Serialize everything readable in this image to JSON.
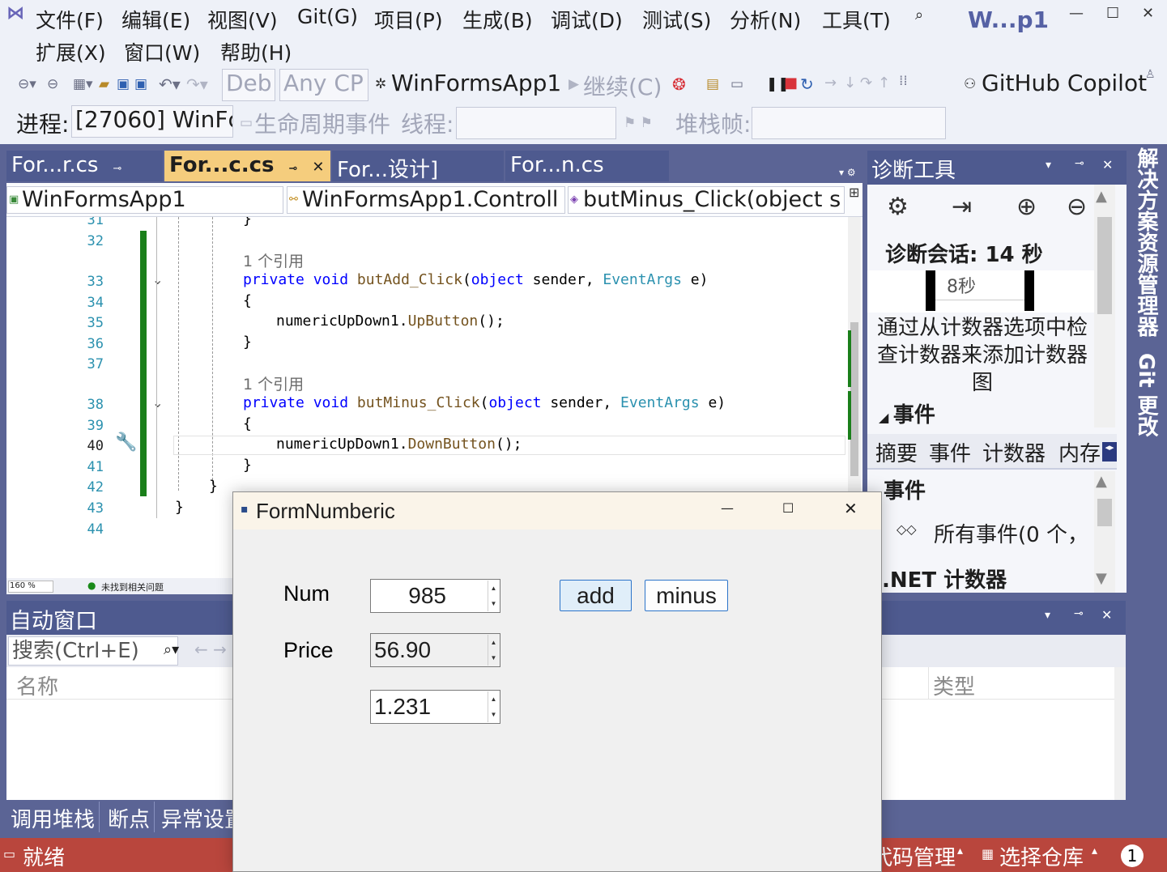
{
  "menu": [
    "文件(F)",
    "编辑(E)",
    "视图(V)",
    "Git(G)",
    "项目(P)",
    "生成(B)",
    "调试(D)",
    "测试(S)",
    "分析(N)",
    "工具(T)",
    "扩展(X)",
    "窗口(W)",
    "帮助(H)"
  ],
  "window": {
    "title": "W...p1",
    "search_icon": "⌕"
  },
  "toolbar": {
    "config": "Deb",
    "platform": "Any CP",
    "startup_project": "WinFormsApp1",
    "continue": "继续(C)",
    "copilot": "GitHub Copilot"
  },
  "debug_location": {
    "process_label": "进程:",
    "process_value": "[27060] WinFc",
    "lifecycle": "生命周期事件",
    "thread_label": "线程:",
    "stack_label": "堆栈帧:"
  },
  "tabs": [
    "For...r.cs",
    "For...c.cs",
    "For...设计]",
    "For...n.cs"
  ],
  "nav": {
    "project": "WinFormsApp1",
    "class": "WinFormsApp1.Controll",
    "member": "butMinus_Click(object s"
  },
  "code": {
    "line_numbers": [
      "31",
      "32",
      "33",
      "34",
      "35",
      "36",
      "37",
      "38",
      "39",
      "40",
      "41",
      "42",
      "43",
      "44"
    ],
    "refs1": "1 个引用",
    "refs2": "1 个引用",
    "add_sig": {
      "mod": "private",
      "ret": "void",
      "name": "butAdd_Click",
      "p1t": "object",
      "p1": "sender,",
      "p2t": "EventArgs",
      "p2": "e)"
    },
    "add_body": {
      "obj": "numericUpDown1.",
      "call": "UpButton",
      "tail": "();"
    },
    "minus_sig": {
      "mod": "private",
      "ret": "void",
      "name": "butMinus_Click",
      "p1t": "object",
      "p1": "sender,",
      "p2t": "EventArgs",
      "p2": "e)"
    },
    "minus_body": {
      "obj": "numericUpDown1.",
      "call": "DownButton",
      "tail": "();"
    }
  },
  "editor_status": {
    "zoom": "160 %",
    "issues": "未找到相关问题"
  },
  "diagnostics": {
    "title": "诊断工具",
    "session": "诊断会话: 14 秒",
    "timeline_tick": "8秒",
    "hint": "通过从计数器选项中检查计数器来添加计数器图",
    "events_header": "事件",
    "subtabs": [
      "摘要",
      "事件",
      "计数器",
      "内存"
    ],
    "events_section": "事件",
    "all_events": "所有事件(0 个，",
    "net_counters": ".NET 计数器"
  },
  "side_tabs": [
    "解决方案资源管理器",
    "Git 更改"
  ],
  "auto_window": {
    "title": "自动窗口",
    "search_placeholder": "搜索(Ctrl+E)",
    "col_name": "名称",
    "col_type": "类型"
  },
  "bottom_tabs": [
    "调用堆栈",
    "断点",
    "异常设置"
  ],
  "status": {
    "ready": "就绪",
    "source_control": "代码管理",
    "select_repo": "选择仓库",
    "notifications": "1"
  },
  "form": {
    "title": "FormNumberic",
    "num_label": "Num",
    "num_value": "985",
    "price_label": "Price",
    "price_value": "56.90",
    "third_value": "1.231",
    "add_label": "add",
    "minus_label": "minus"
  }
}
